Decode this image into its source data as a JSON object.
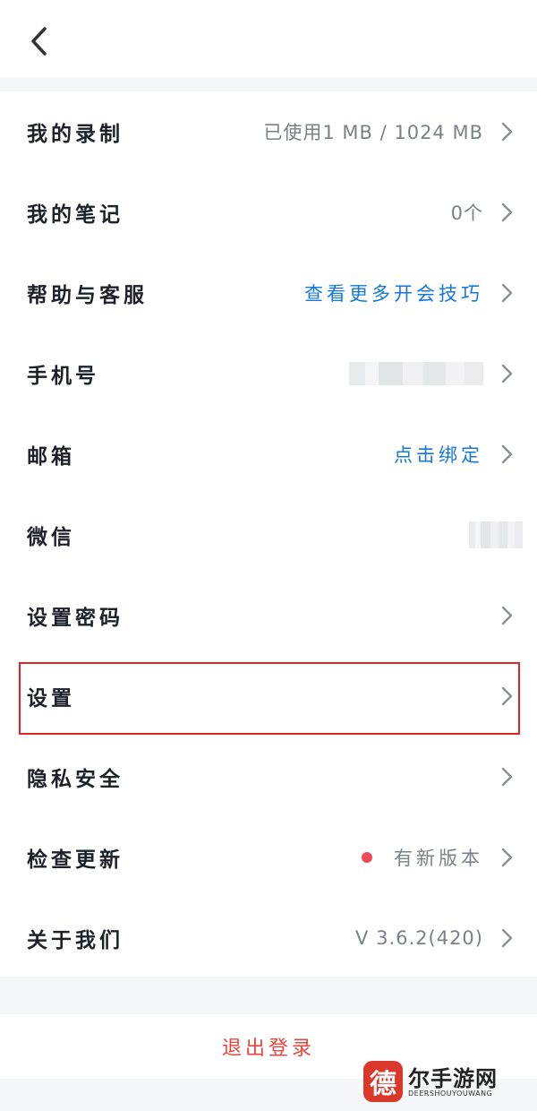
{
  "rows": [
    {
      "label": "我的录制",
      "value": "已使用1 MB / 1024 MB"
    },
    {
      "label": "我的笔记",
      "value": "0个"
    },
    {
      "label": "帮助与客服",
      "value": "查看更多开会技巧"
    },
    {
      "label": "手机号",
      "value": ""
    },
    {
      "label": "邮箱",
      "value": "点击绑定"
    },
    {
      "label": "微信",
      "value": ""
    },
    {
      "label": "设置密码",
      "value": ""
    },
    {
      "label": "设置",
      "value": ""
    },
    {
      "label": "隐私安全",
      "value": ""
    },
    {
      "label": "检查更新",
      "value": "有新版本"
    },
    {
      "label": "关于我们",
      "value": "V 3.6.2(420)"
    }
  ],
  "logout_label": "退出登录",
  "colors": {
    "link": "#1677d9",
    "logout": "#e8463c",
    "update_dot": "#f24957",
    "highlight": "#e02424"
  },
  "watermark": {
    "logo_char": "德",
    "title": "尔手游网",
    "subtitle": "DEERSHOUYOUWANG"
  }
}
